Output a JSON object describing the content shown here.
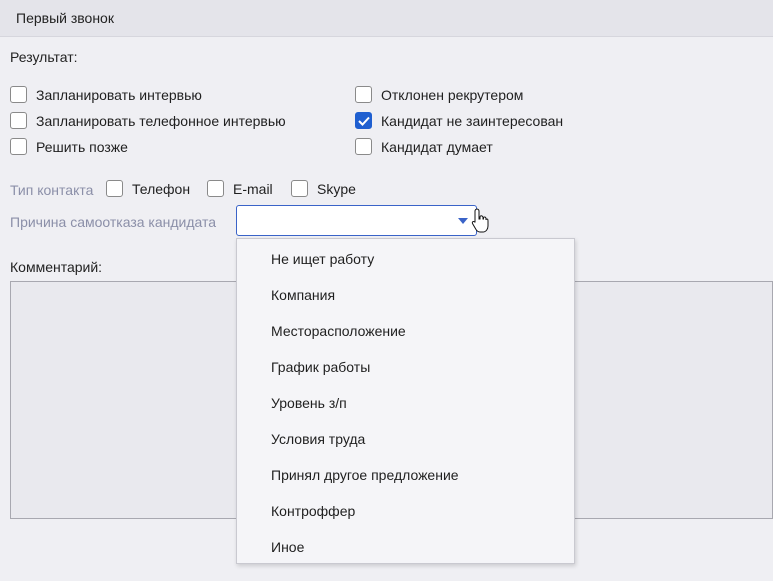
{
  "header": {
    "title": "Первый звонок"
  },
  "result": {
    "label": "Результат:",
    "options": [
      {
        "label": "Запланировать интервью",
        "checked": false
      },
      {
        "label": "Запланировать телефонное интервью",
        "checked": false
      },
      {
        "label": "Решить позже",
        "checked": false
      },
      {
        "label": "Отклонен рекрутером",
        "checked": false
      },
      {
        "label": "Кандидат не заинтересован",
        "checked": true
      },
      {
        "label": "Кандидат думает",
        "checked": false
      }
    ]
  },
  "contact_type": {
    "label": "Тип контакта",
    "options": [
      {
        "label": "Телефон",
        "checked": false
      },
      {
        "label": "E-mail",
        "checked": false
      },
      {
        "label": "Skype",
        "checked": false
      }
    ]
  },
  "refusal_reason": {
    "label": "Причина самоотказа кандидата",
    "selected": "",
    "options": [
      "Не ищет работу",
      "Компания",
      "Месторасположение",
      "График работы",
      "Уровень з/п",
      "Условия труда",
      "Принял другое предложение",
      "Контроффер",
      "Иное"
    ]
  },
  "comment": {
    "label": "Комментарий:",
    "value": ""
  },
  "colors": {
    "accent": "#1f5fd0",
    "select_border": "#3a63c8",
    "muted_label": "#8b8fa8"
  }
}
